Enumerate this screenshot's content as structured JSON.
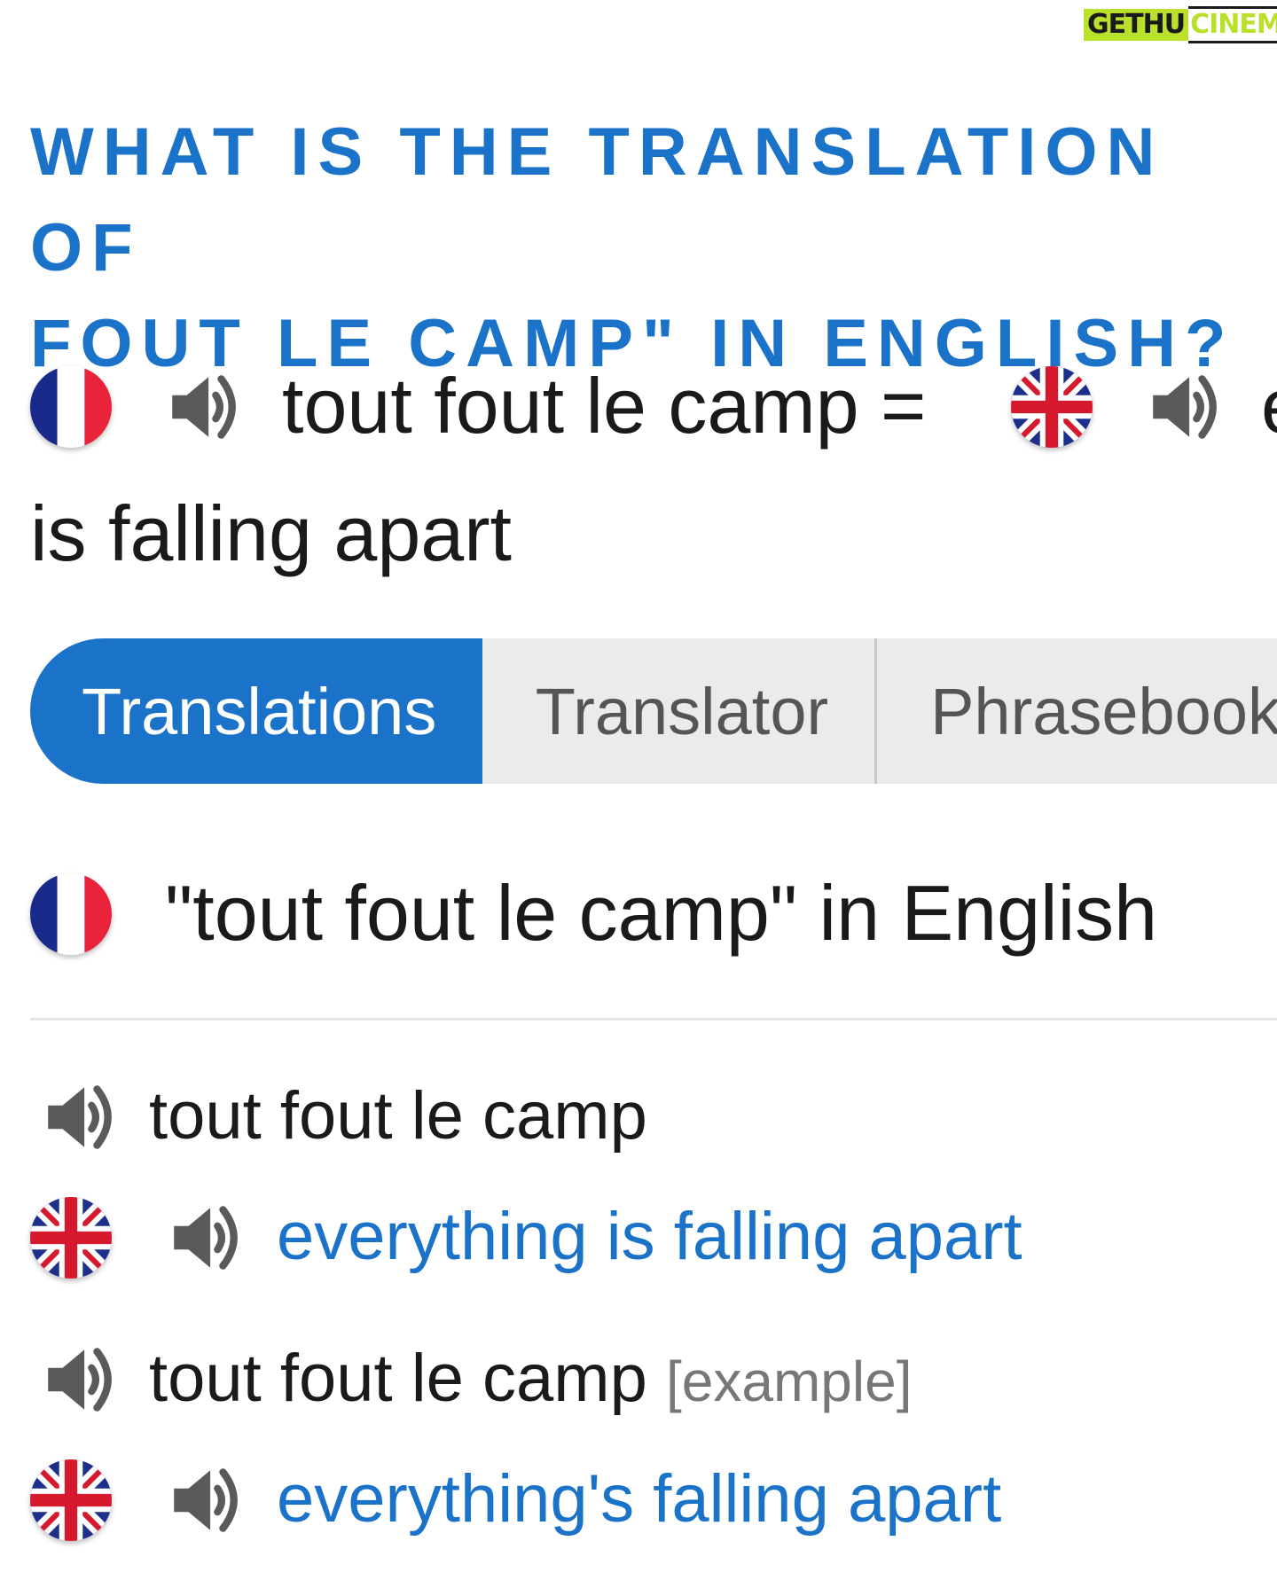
{
  "watermark": {
    "part1": "GETHU",
    "part2": "CINEMA"
  },
  "heading": {
    "line1": "WHAT IS THE TRANSLATION OF",
    "line2": "FOUT LE CAMP\" IN ENGLISH?"
  },
  "summary": {
    "source": "tout fout le camp =",
    "target_start": "e",
    "target_rest": "is falling apart"
  },
  "tabs": [
    {
      "label": "Translations",
      "active": true
    },
    {
      "label": "Translator",
      "active": false
    },
    {
      "label": "Phrasebook",
      "active": false
    }
  ],
  "section": {
    "title": "\"tout fout le camp\" in English"
  },
  "entries": [
    {
      "source": "tout fout le camp",
      "hint": "",
      "target": "everything is falling apart"
    },
    {
      "source": "tout fout le camp",
      "hint": "[example]",
      "target": "everything's falling apart"
    }
  ],
  "colors": {
    "accent": "#1a73c9",
    "tab_bg": "#ebebeb",
    "watermark": "#b9e02b"
  },
  "icons": [
    "french-flag-icon",
    "uk-flag-icon",
    "speaker-icon"
  ]
}
